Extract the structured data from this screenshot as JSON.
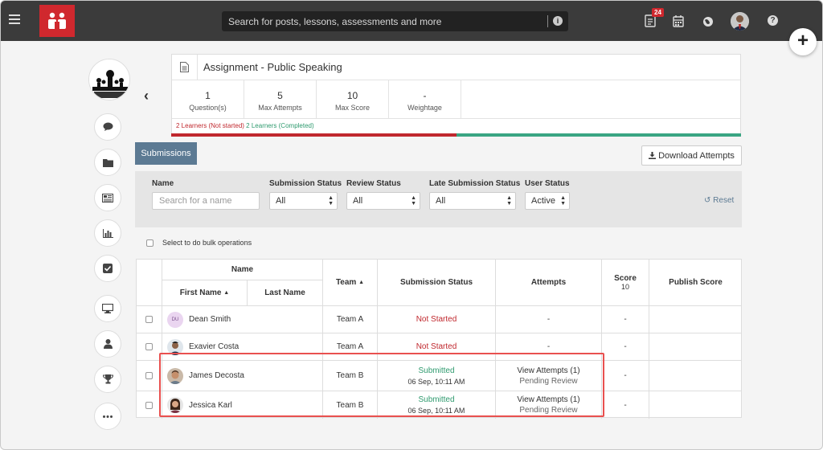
{
  "topbar": {
    "search_placeholder": "Search for posts, lessons, assessments and more",
    "notification_count": "24",
    "help_label": "?"
  },
  "fab_label": "+",
  "assignment": {
    "title": "Assignment - Public Speaking",
    "stats": [
      {
        "value": "1",
        "label": "Question(s)"
      },
      {
        "value": "5",
        "label": "Max Attempts"
      },
      {
        "value": "10",
        "label": "Max Score"
      },
      {
        "value": "-",
        "label": "Weightage"
      }
    ],
    "learners_not_started": "2 Learners (Not started)",
    "learners_completed": "2 Learners (Completed)",
    "completed_fraction": 0.5
  },
  "tabs": {
    "submissions": "Submissions"
  },
  "download_label": "Download Attempts",
  "filters": {
    "name_label": "Name",
    "name_placeholder": "Search for a name",
    "submission_status_label": "Submission Status",
    "submission_status_value": "All",
    "review_status_label": "Review Status",
    "review_status_value": "All",
    "late_submission_label": "Late Submission Status",
    "late_submission_value": "All",
    "user_status_label": "User Status",
    "user_status_value": "Active",
    "reset_label": "Reset"
  },
  "bulk_label": "Select to do bulk operations",
  "table": {
    "name_header": "Name",
    "first_name_header": "First Name",
    "last_name_header": "Last Name",
    "team_header": "Team",
    "submission_status_header": "Submission Status",
    "attempts_header": "Attempts",
    "score_header": "Score",
    "score_max": "10",
    "publish_score_header": "Publish Score",
    "rows": [
      {
        "initials": "DU",
        "name": "Dean Smith",
        "team": "Team A",
        "status": "Not Started",
        "date": "",
        "attempts": "-",
        "review": "",
        "score": "-"
      },
      {
        "initials": "",
        "name": "Exavier Costa",
        "team": "Team A",
        "status": "Not Started",
        "date": "",
        "attempts": "-",
        "review": "",
        "score": "-"
      },
      {
        "initials": "",
        "name": "James Decosta",
        "team": "Team B",
        "status": "Submitted",
        "date": "06 Sep, 10:11 AM",
        "attempts": "View Attempts (1)",
        "review": "Pending Review",
        "score": "-"
      },
      {
        "initials": "",
        "name": "Jessica Karl",
        "team": "Team B",
        "status": "Submitted",
        "date": "06 Sep, 10:11 AM",
        "attempts": "View Attempts (1)",
        "review": "Pending Review",
        "score": "-"
      }
    ]
  },
  "colors": {
    "topbar": "#3b3b3b",
    "brand": "#d0282e",
    "tab": "#5c7a93",
    "not_started": "#c0282e",
    "completed": "#2e9a6e",
    "highlight": "#e9504f"
  }
}
